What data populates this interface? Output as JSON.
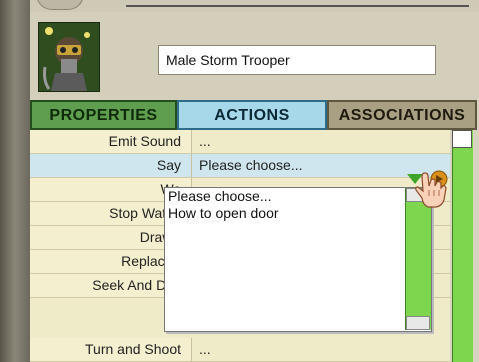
{
  "object_name": "Male Storm Trooper",
  "tabs": [
    {
      "label": "PROPERTIES"
    },
    {
      "label": "ACTIONS"
    },
    {
      "label": "ASSOCIATIONS"
    }
  ],
  "actions": [
    {
      "label": "Emit Sound",
      "value": "..."
    },
    {
      "label": "Say",
      "value": "Please choose..."
    },
    {
      "label": "Wa",
      "value": ""
    },
    {
      "label": "Stop Watch",
      "value": ""
    },
    {
      "label": "Draw (",
      "value": ""
    },
    {
      "label": "Replace (",
      "value": ""
    },
    {
      "label": "Seek And Des",
      "value": ""
    },
    {
      "label": "Turn and Shoot",
      "value": "..."
    }
  ],
  "dropdown_options": [
    {
      "label": "Please choose..."
    },
    {
      "label": "How to open door"
    }
  ],
  "colors": {
    "properties_tab": "#5f9e4e",
    "actions_tab": "#a7d8ea",
    "associations_tab": "#a99f82",
    "scrollbar": "#7ed64e"
  }
}
